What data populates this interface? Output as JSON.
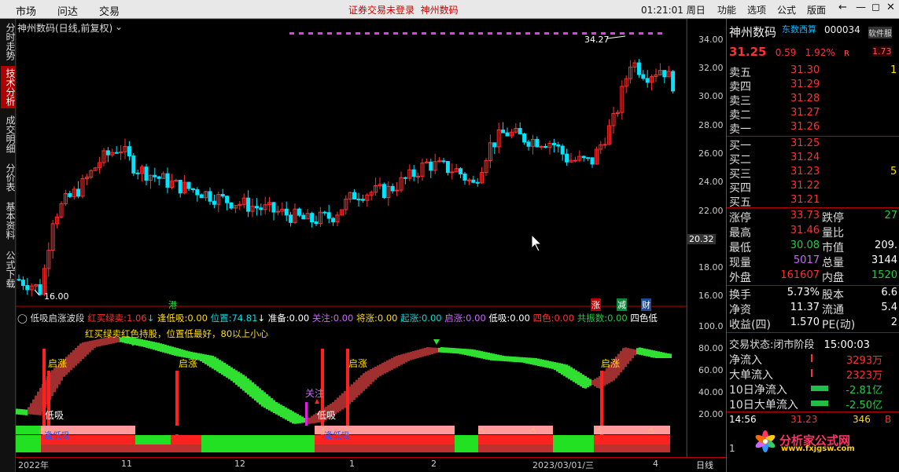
{
  "topbar": {
    "menus": [
      "市场",
      "问达",
      "交易"
    ],
    "notice": "证券交易未登录",
    "broker": "神州数码",
    "clock": "01:21:01 周日",
    "right_menus": [
      "功能",
      "选项",
      "公式",
      "版面"
    ],
    "back": "←",
    "min": "—",
    "restore": "◻",
    "close": "✕"
  },
  "left_tabs": [
    "分时走势",
    "技术分析",
    "成交明细",
    "分价表",
    "基本资料",
    "公式下载"
  ],
  "chart": {
    "title": "神州数码(日线,前复权)",
    "high_label": "34.27",
    "low_label": "16.00",
    "price_cursor": "20.32",
    "y_ticks": [
      "34.00",
      "32.00",
      "30.00",
      "28.00",
      "26.00",
      "24.00",
      "22.00",
      "20.00",
      "18.00",
      "16.00"
    ],
    "ind_y_ticks": [
      "100.0",
      "80.00",
      "60.00",
      "40.00",
      "20.00"
    ],
    "x_ticks": [
      "2022年",
      "11",
      "12",
      "1",
      "2",
      "2023/03/01/三",
      "4"
    ],
    "period": "日线",
    "markers": {
      "gang": "港",
      "zhang": "涨",
      "jian": "减",
      "cai": "财"
    }
  },
  "indicator": {
    "name": "低吸启涨波段",
    "items": [
      {
        "label": "红买绿卖:",
        "value": "1.06"
      },
      {
        "label": "逢低吸:",
        "value": "0.00"
      },
      {
        "label": "位置:",
        "value": "74.81"
      },
      {
        "label": "准备:",
        "value": "0.00"
      },
      {
        "label": "关注:",
        "value": "0.00"
      },
      {
        "label": "将涨:",
        "value": "0.00"
      },
      {
        "label": "起涨:",
        "value": "0.00"
      },
      {
        "label": "启涨:",
        "value": "0.00"
      },
      {
        "label": "低吸:",
        "value": "0.00"
      },
      {
        "label": "四色:",
        "value": "0.00"
      },
      {
        "label": "共振数:",
        "value": "0.00"
      },
      {
        "label": "四色低",
        "value": ""
      }
    ],
    "hint": "红买绿卖红色持股，位置低最好，80以上小心",
    "labels": {
      "qizhang": "启涨",
      "dixi": "低吸",
      "fengdixi": "逢低吸",
      "guanzhu": "关注"
    }
  },
  "quote": {
    "name": "神州数码",
    "tag": "东数西算",
    "code": "000034",
    "soft": "软件服",
    "price": "31.25",
    "change": "0.59",
    "pct": "1.92%",
    "r_label": "R",
    "side_val": "1.73",
    "asks": [
      {
        "label": "卖五",
        "price": "31.30",
        "vol": "1"
      },
      {
        "label": "卖四",
        "price": "31.29",
        "vol": ""
      },
      {
        "label": "卖三",
        "price": "31.28",
        "vol": ""
      },
      {
        "label": "卖二",
        "price": "31.27",
        "vol": ""
      },
      {
        "label": "卖一",
        "price": "31.26",
        "vol": ""
      }
    ],
    "bids": [
      {
        "label": "买一",
        "price": "31.25",
        "vol": ""
      },
      {
        "label": "买二",
        "price": "31.24",
        "vol": ""
      },
      {
        "label": "买三",
        "price": "31.23",
        "vol": "5"
      },
      {
        "label": "买四",
        "price": "31.22",
        "vol": ""
      },
      {
        "label": "买五",
        "price": "31.21",
        "vol": ""
      }
    ],
    "stats": [
      {
        "l1": "涨停",
        "v1": "33.73",
        "l2": "跌停",
        "v2": "27"
      },
      {
        "l1": "最高",
        "v1": "31.46",
        "l2": "量比",
        "v2": ""
      },
      {
        "l1": "最低",
        "v1": "30.08",
        "l2": "市值",
        "v2": "209."
      },
      {
        "l1": "现量",
        "v1": "5017",
        "l2": "总量",
        "v2": "3144"
      },
      {
        "l1": "外盘",
        "v1": "161607",
        "l2": "内盘",
        "v2": "1520"
      }
    ],
    "stats2": [
      {
        "l1": "换手",
        "v1": "5.73%",
        "l2": "股本",
        "v2": "6.6"
      },
      {
        "l1": "净资",
        "v1": "11.37",
        "l2": "流通",
        "v2": "5.4"
      },
      {
        "l1": "收益(四)",
        "v1": "1.570",
        "l2": "PE(动)",
        "v2": "2"
      }
    ],
    "trade_state_label": "交易状态:",
    "trade_state": "闭市阶段",
    "trade_time": "15:00:03",
    "flows": [
      {
        "label": "净流入",
        "value": "3293万"
      },
      {
        "label": "大单流入",
        "value": "2323万"
      },
      {
        "label": "10日净流入",
        "value": "-2.81亿"
      },
      {
        "label": "10日大单流入",
        "value": "-2.50亿"
      }
    ],
    "last_trade": {
      "time": "14:56",
      "price": "31.23",
      "vol": "346",
      "side": "B"
    },
    "extra_row": "1"
  },
  "logo": "分析家公式网",
  "logo_url": "www.fxjgsw.com",
  "colors": {
    "up": "#ff3030",
    "down": "#00e5ff",
    "accent": "#b00000"
  }
}
